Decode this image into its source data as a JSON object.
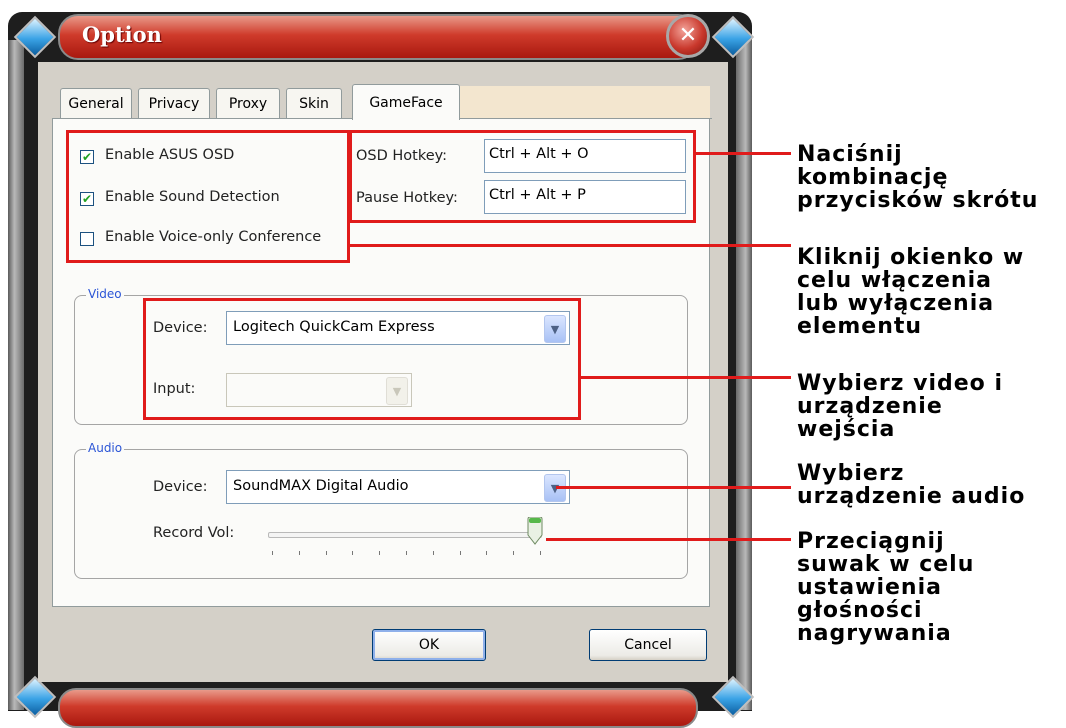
{
  "window": {
    "title": "Option"
  },
  "tabs": [
    {
      "label": "General"
    },
    {
      "label": "Privacy"
    },
    {
      "label": "Proxy"
    },
    {
      "label": "Skin"
    },
    {
      "label": "GameFace"
    }
  ],
  "options": {
    "enable_osd": {
      "label": "Enable ASUS OSD",
      "checked": true
    },
    "enable_sound": {
      "label": "Enable Sound Detection",
      "checked": true
    },
    "enable_voice": {
      "label": "Enable Voice-only Conference",
      "checked": false
    }
  },
  "hotkeys": {
    "osd_label": "OSD Hotkey:",
    "osd_value": "Ctrl + Alt + O",
    "pause_label": "Pause Hotkey:",
    "pause_value": "Ctrl + Alt + P"
  },
  "video": {
    "group_title": "Video",
    "device_label": "Device:",
    "device_value": "Logitech QuickCam Express",
    "input_label": "Input:",
    "input_value": ""
  },
  "audio": {
    "group_title": "Audio",
    "device_label": "Device:",
    "device_value": "SoundMAX Digital Audio",
    "record_label": "Record Vol:",
    "record_level_fraction": 1.0
  },
  "buttons": {
    "ok": "OK",
    "cancel": "Cancel"
  },
  "annotations": {
    "hotkeys": "Naciśnij\nkombinację\nprzycisków skrótu",
    "checkbox": "Kliknij okienko w\ncelu włączenia\nlub wyłączenia\nelementu",
    "video": "Wybierz video i\nurządzenie\nwejścia",
    "audio": "Wybierz\nurządzenie audio",
    "slider": "Przeciągnij\nsuwak w celu\nustawienia\ngłośności\nnagrywania"
  },
  "colors": {
    "highlight": "#e01b1b",
    "titlebar": "#cf3b2b",
    "group_title": "#2b55d6"
  }
}
